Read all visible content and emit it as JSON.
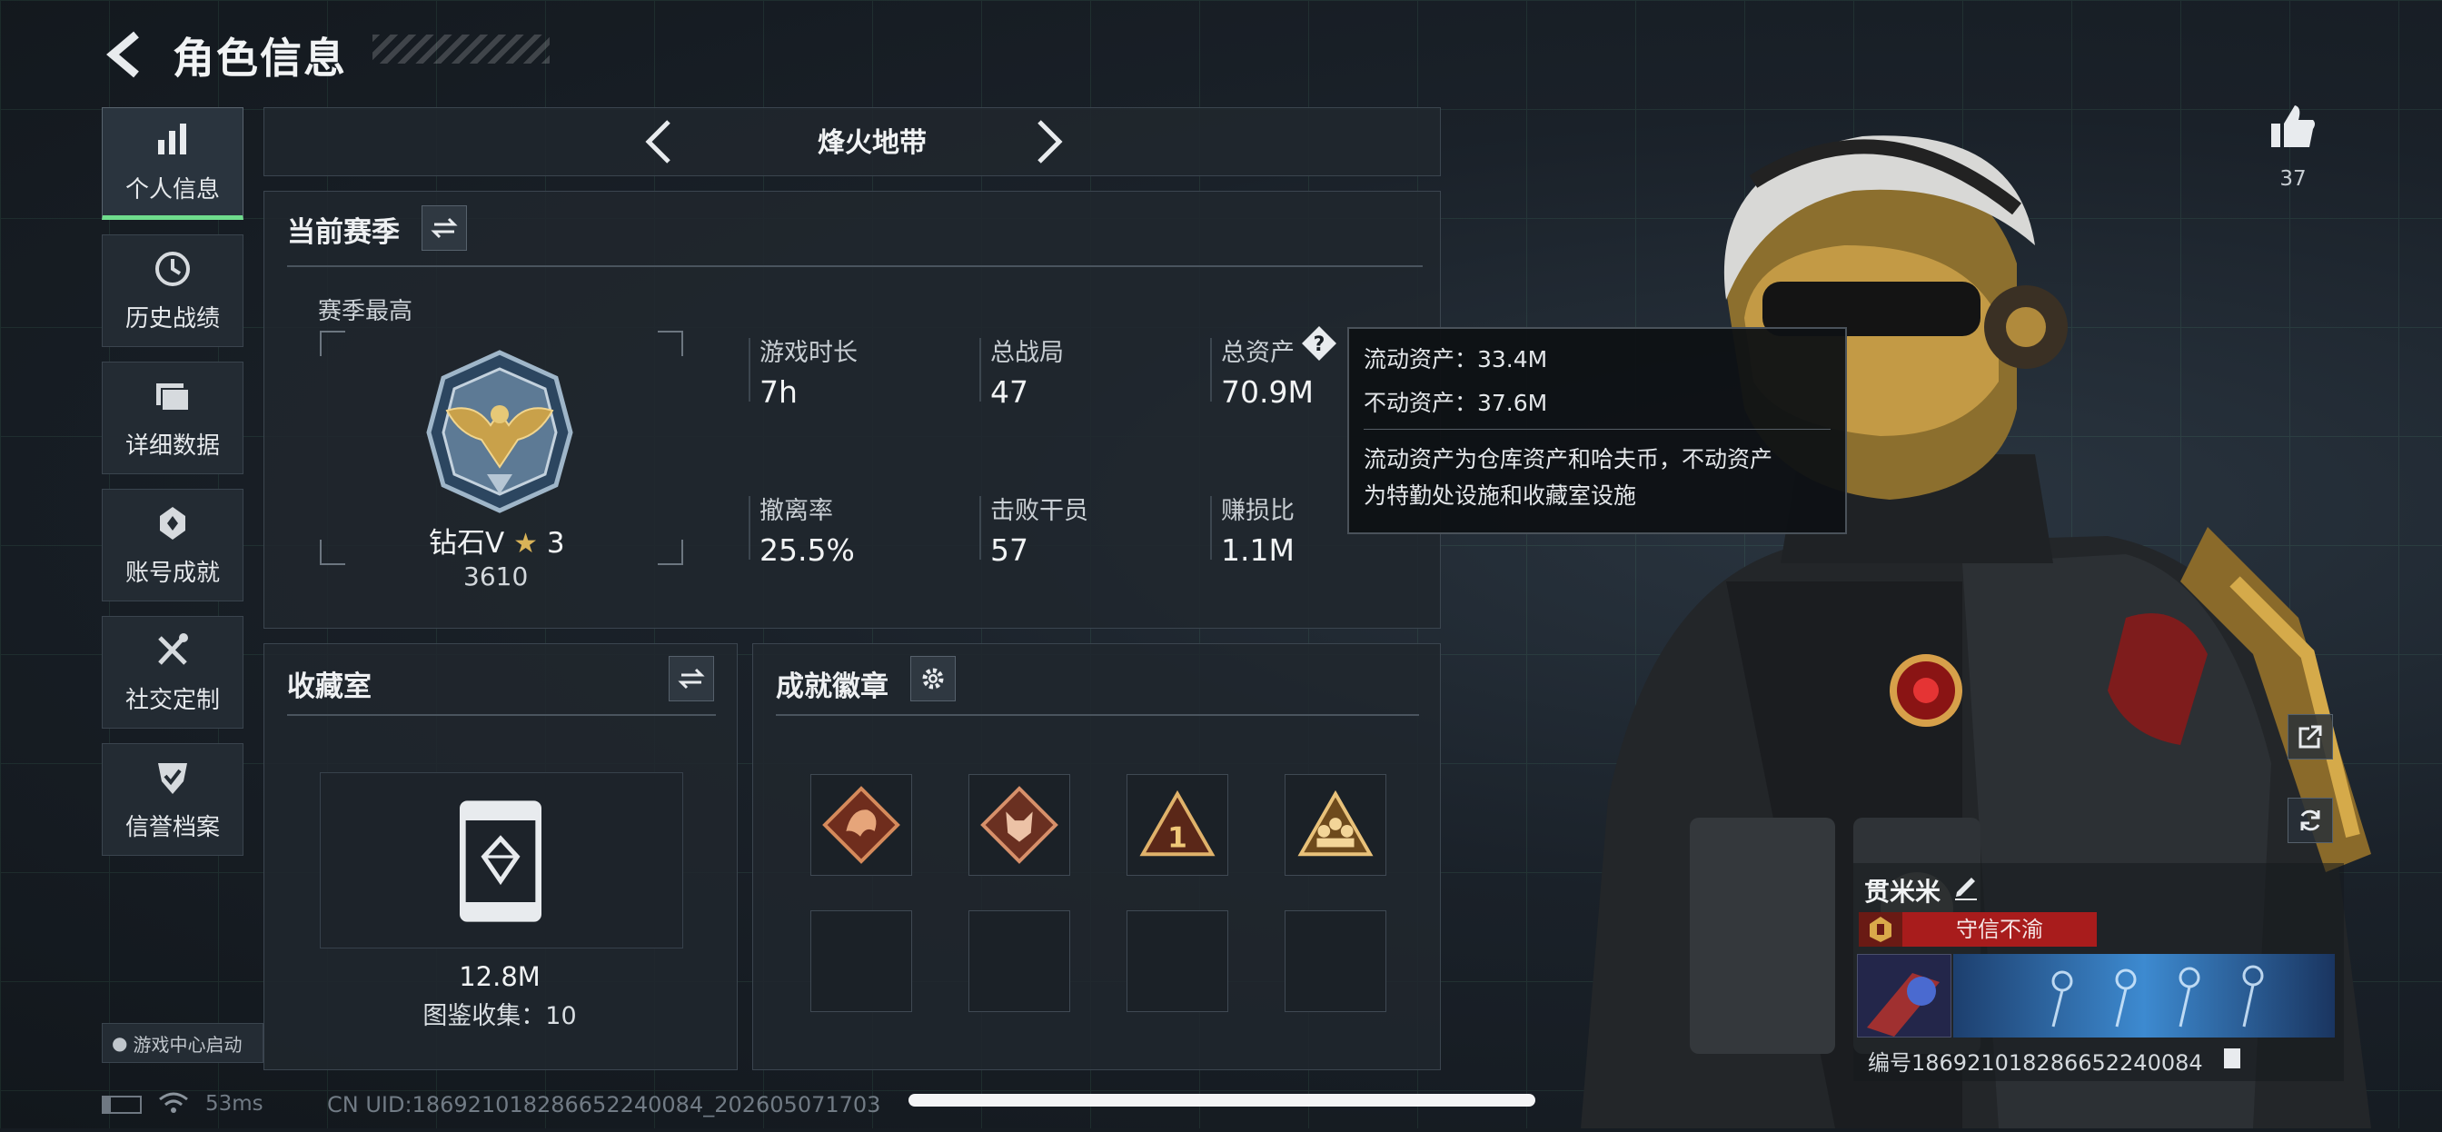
{
  "header": {
    "title": "角色信息"
  },
  "sidebar": {
    "items": [
      {
        "label": "个人信息",
        "icon": "bar-chart-icon"
      },
      {
        "label": "历史战绩",
        "icon": "history-clock-icon"
      },
      {
        "label": "详细数据",
        "icon": "folder-icon"
      },
      {
        "label": "账号成就",
        "icon": "medal-icon"
      },
      {
        "label": "社交定制",
        "icon": "tools-icon"
      },
      {
        "label": "信誉档案",
        "icon": "shield-check-icon"
      }
    ],
    "game_center_label": "游戏中心启动"
  },
  "mode_selector": {
    "current": "烽火地带"
  },
  "season": {
    "title": "当前赛季",
    "best_label": "赛季最高",
    "rank_name": "钻石V",
    "rank_stars": "3",
    "rank_points": "3610",
    "stats": [
      {
        "label": "游戏时长",
        "value": "7h"
      },
      {
        "label": "总战局",
        "value": "47"
      },
      {
        "label": "总资产",
        "value": "70.9M"
      },
      {
        "label": "撤离率",
        "value": "25.5%"
      },
      {
        "label": "击败干员",
        "value": "57"
      },
      {
        "label": "赚损比",
        "value": "1.1M"
      }
    ]
  },
  "tooltip": {
    "liquid": "流动资产：33.4M",
    "fixed": "不动资产：37.6M",
    "desc1": "流动资产为仓库资产和哈夫币，不动资产",
    "desc2": "为特勤处设施和收藏室设施"
  },
  "collection": {
    "title": "收藏室",
    "value": "12.8M",
    "catalog": "图鉴收集：10"
  },
  "achievements": {
    "title": "成就徽章"
  },
  "player": {
    "likes": "37",
    "name": "贯米米",
    "title": "守信不渝",
    "uid_label": "编号18692101828665224008​4"
  },
  "status_bar": {
    "ping": "53ms",
    "uid": "CN UID:18692101828665224008​4_202605071703"
  },
  "colors": {
    "accent_green": "#6fdd8d",
    "title_red": "#a81c1c",
    "gold": "#c9a14a"
  }
}
